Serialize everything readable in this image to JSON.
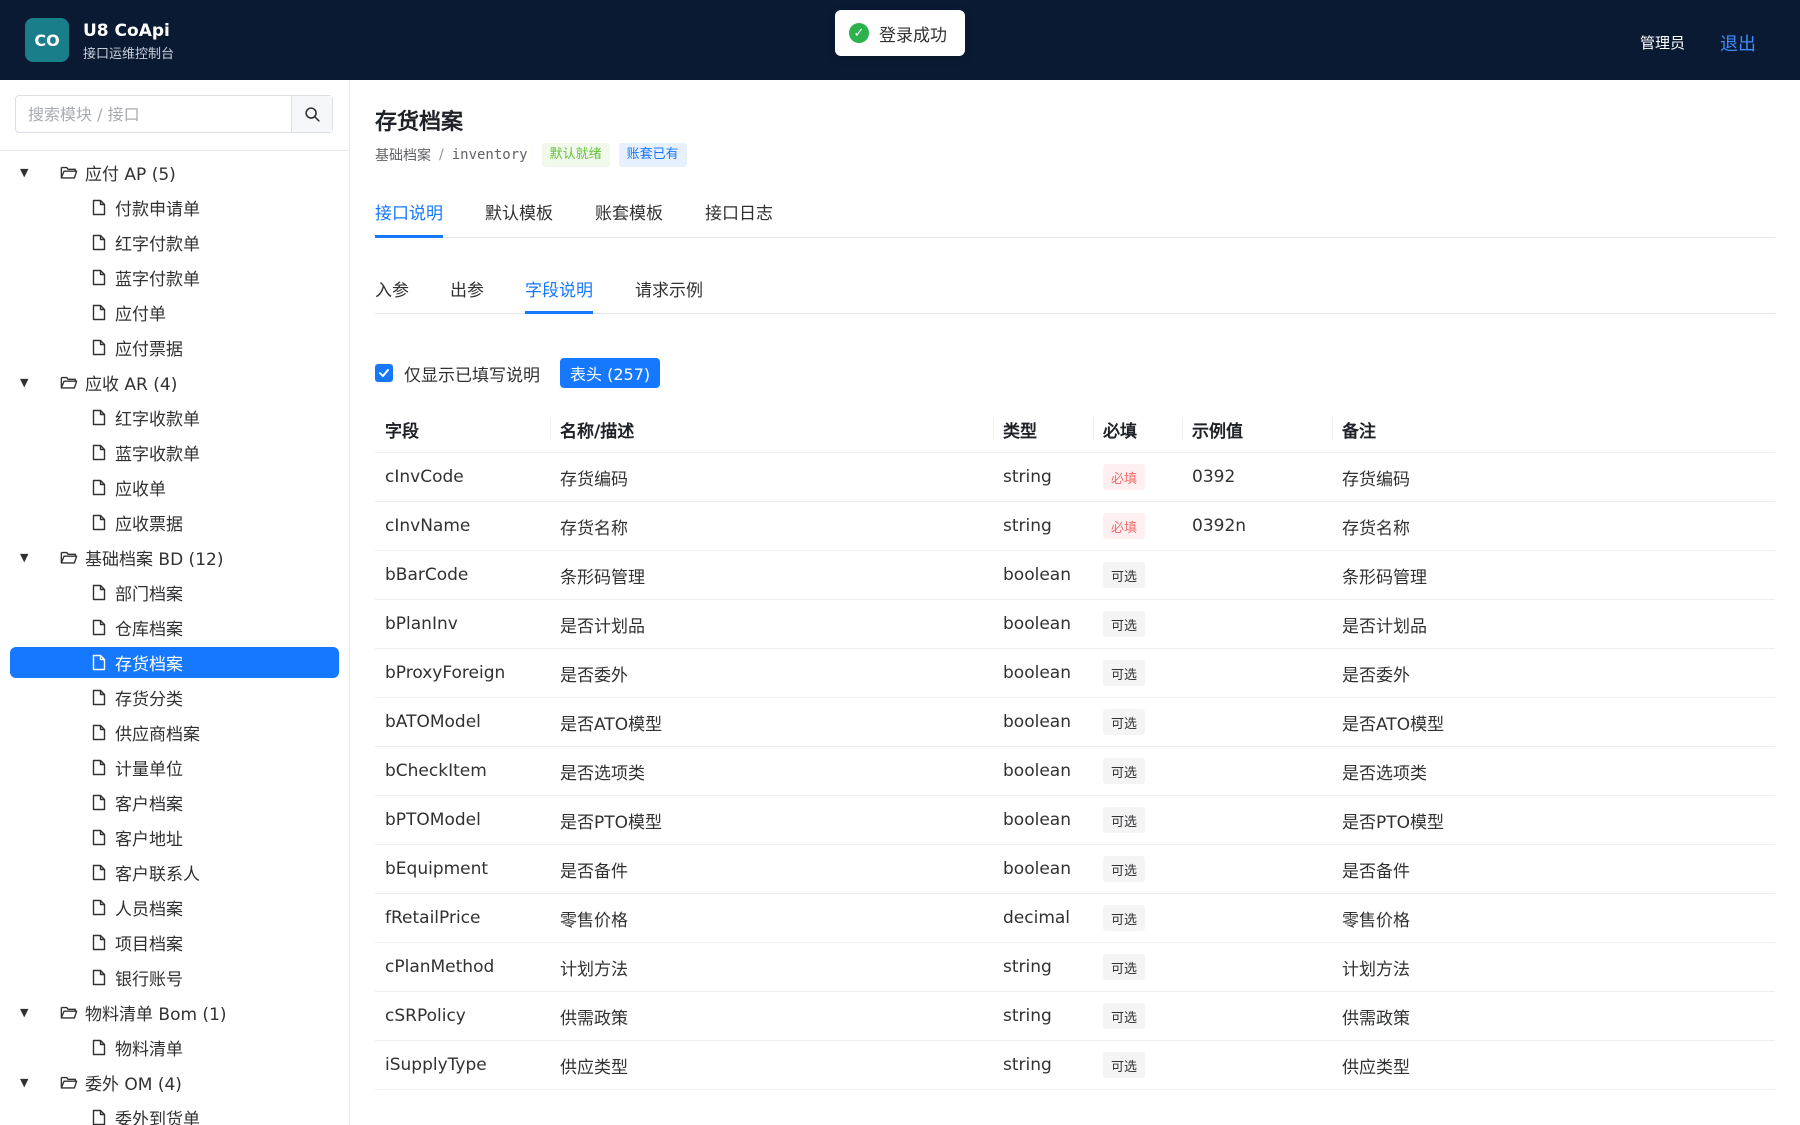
{
  "header": {
    "logo_text": "CO",
    "app_title": "U8 CoApi",
    "app_subtitle": "接口运维控制台",
    "user_name": "管理员",
    "logout_label": "退出"
  },
  "toast": {
    "message": "登录成功"
  },
  "sidebar": {
    "search_placeholder": "搜索模块 / 接口",
    "tree": [
      {
        "type": "folder",
        "label": "应付 AP (5)"
      },
      {
        "type": "leaf",
        "label": "付款申请单"
      },
      {
        "type": "leaf",
        "label": "红字付款单"
      },
      {
        "type": "leaf",
        "label": "蓝字付款单"
      },
      {
        "type": "leaf",
        "label": "应付单"
      },
      {
        "type": "leaf",
        "label": "应付票据"
      },
      {
        "type": "folder",
        "label": "应收 AR (4)"
      },
      {
        "type": "leaf",
        "label": "红字收款单"
      },
      {
        "type": "leaf",
        "label": "蓝字收款单"
      },
      {
        "type": "leaf",
        "label": "应收单"
      },
      {
        "type": "leaf",
        "label": "应收票据"
      },
      {
        "type": "folder",
        "label": "基础档案 BD (12)"
      },
      {
        "type": "leaf",
        "label": "部门档案"
      },
      {
        "type": "leaf",
        "label": "仓库档案"
      },
      {
        "type": "leaf",
        "label": "存货档案",
        "active": true
      },
      {
        "type": "leaf",
        "label": "存货分类"
      },
      {
        "type": "leaf",
        "label": "供应商档案"
      },
      {
        "type": "leaf",
        "label": "计量单位"
      },
      {
        "type": "leaf",
        "label": "客户档案"
      },
      {
        "type": "leaf",
        "label": "客户地址"
      },
      {
        "type": "leaf",
        "label": "客户联系人"
      },
      {
        "type": "leaf",
        "label": "人员档案"
      },
      {
        "type": "leaf",
        "label": "项目档案"
      },
      {
        "type": "leaf",
        "label": "银行账号"
      },
      {
        "type": "folder",
        "label": "物料清单 Bom (1)"
      },
      {
        "type": "leaf",
        "label": "物料清单"
      },
      {
        "type": "folder",
        "label": "委外 OM (4)"
      },
      {
        "type": "leaf",
        "label": "委外到货单"
      }
    ]
  },
  "main": {
    "title": "存货档案",
    "breadcrumb": {
      "module": "基础档案",
      "separator": "/",
      "code": "inventory"
    },
    "tags": {
      "default_ready": "默认就绪",
      "account_exists": "账套已有"
    },
    "tabs": [
      {
        "label": "接口说明",
        "active": true
      },
      {
        "label": "默认模板"
      },
      {
        "label": "账套模板"
      },
      {
        "label": "接口日志"
      }
    ],
    "subtabs": [
      {
        "label": "入参"
      },
      {
        "label": "出参"
      },
      {
        "label": "字段说明",
        "active": true
      },
      {
        "label": "请求示例"
      }
    ],
    "filter": {
      "checkbox_label": "仅显示已填写说明",
      "checked": true,
      "badge": "表头 (257)"
    },
    "table": {
      "columns": [
        "字段",
        "名称/描述",
        "类型",
        "必填",
        "示例值",
        "备注"
      ],
      "rows": [
        {
          "field": "cInvCode",
          "desc": "存货编码",
          "type": "string",
          "required": "必填",
          "is_required": true,
          "example": "0392",
          "note": "存货编码"
        },
        {
          "field": "cInvName",
          "desc": "存货名称",
          "type": "string",
          "required": "必填",
          "is_required": true,
          "example": "0392n",
          "note": "存货名称"
        },
        {
          "field": "bBarCode",
          "desc": "条形码管理",
          "type": "boolean",
          "required": "可选",
          "example": "",
          "note": "条形码管理"
        },
        {
          "field": "bPlanInv",
          "desc": "是否计划品",
          "type": "boolean",
          "required": "可选",
          "example": "",
          "note": "是否计划品"
        },
        {
          "field": "bProxyForeign",
          "desc": "是否委外",
          "type": "boolean",
          "required": "可选",
          "example": "",
          "note": "是否委外"
        },
        {
          "field": "bATOModel",
          "desc": "是否ATO模型",
          "type": "boolean",
          "required": "可选",
          "example": "",
          "note": "是否ATO模型"
        },
        {
          "field": "bCheckItem",
          "desc": "是否选项类",
          "type": "boolean",
          "required": "可选",
          "example": "",
          "note": "是否选项类"
        },
        {
          "field": "bPTOModel",
          "desc": "是否PTO模型",
          "type": "boolean",
          "required": "可选",
          "example": "",
          "note": "是否PTO模型"
        },
        {
          "field": "bEquipment",
          "desc": "是否备件",
          "type": "boolean",
          "required": "可选",
          "example": "",
          "note": "是否备件"
        },
        {
          "field": "fRetailPrice",
          "desc": "零售价格",
          "type": "decimal",
          "required": "可选",
          "example": "",
          "note": "零售价格"
        },
        {
          "field": "cPlanMethod",
          "desc": "计划方法",
          "type": "string",
          "required": "可选",
          "example": "",
          "note": "计划方法"
        },
        {
          "field": "cSRPolicy",
          "desc": "供需政策",
          "type": "string",
          "required": "可选",
          "example": "",
          "note": "供需政策"
        },
        {
          "field": "iSupplyType",
          "desc": "供应类型",
          "type": "string",
          "required": "可选",
          "example": "",
          "note": "供应类型"
        }
      ]
    }
  },
  "colors": {
    "header_bg": "#0b1a33",
    "accent": "#1677ff",
    "logo_bg": "#1a7e8a",
    "success": "#2bb24c",
    "required": "#f56c6c"
  }
}
